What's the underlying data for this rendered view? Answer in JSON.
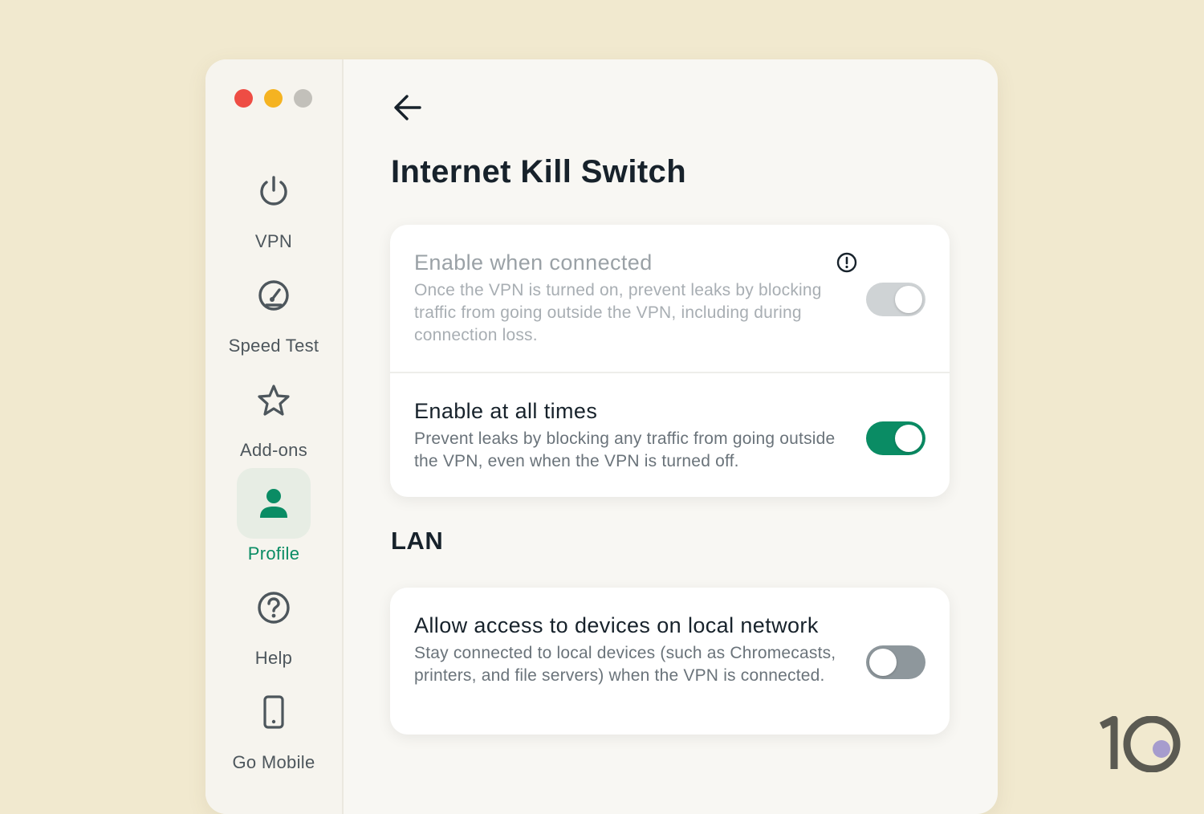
{
  "window_controls": [
    "close",
    "minimize",
    "zoom"
  ],
  "sidebar": {
    "items": [
      {
        "label": "VPN",
        "icon": "power-icon",
        "active": false
      },
      {
        "label": "Speed Test",
        "icon": "gauge-icon",
        "active": false
      },
      {
        "label": "Add-ons",
        "icon": "star-icon",
        "active": false
      },
      {
        "label": "Profile",
        "icon": "person-icon",
        "active": true
      },
      {
        "label": "Help",
        "icon": "question-icon",
        "active": false
      },
      {
        "label": "Go Mobile",
        "icon": "phone-icon",
        "active": false
      }
    ]
  },
  "page": {
    "title": "Internet Kill Switch",
    "back_icon": "arrow-left-icon"
  },
  "kill_switch": {
    "enable_when_connected": {
      "title": "Enable when connected",
      "description": "Once the VPN is turned on, prevent leaks by blocking traffic from going outside the VPN, including during connection loss.",
      "state": "on-disabled",
      "info_icon": "exclamation-circle-icon"
    },
    "enable_at_all_times": {
      "title": "Enable at all times",
      "description": "Prevent leaks by blocking any traffic from going outside the VPN, even when the VPN is turned off.",
      "state": "on"
    }
  },
  "lan": {
    "heading": "LAN",
    "allow_local": {
      "title": "Allow access to devices on local network",
      "description": "Stay connected to local devices (such as Chromecasts, printers, and file servers) when the VPN is connected.",
      "state": "off"
    }
  },
  "watermark": {
    "icon": "ten-logo"
  },
  "colors": {
    "background": "#f1e9cf",
    "accent": "#0a8c64",
    "text_primary": "#17222b",
    "text_secondary": "#6a737a"
  }
}
